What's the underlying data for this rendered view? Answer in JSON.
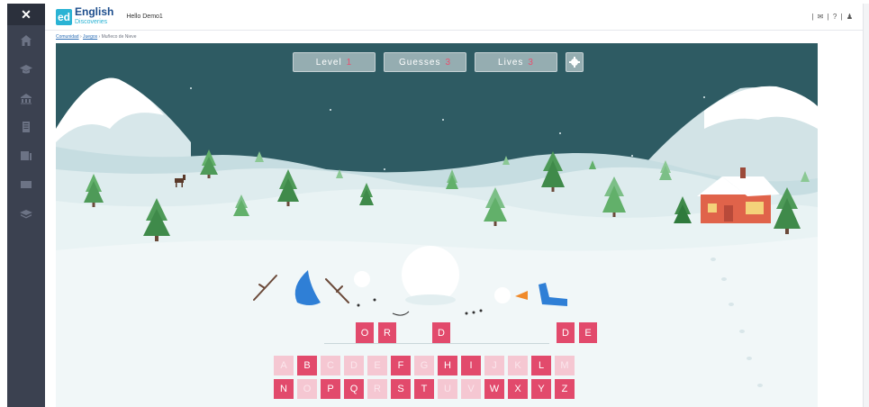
{
  "sidebar": {
    "close_label": "✕",
    "items": [
      {
        "icon": "home-icon"
      },
      {
        "icon": "graduation-cap-icon"
      },
      {
        "icon": "community-icon"
      },
      {
        "icon": "document-icon"
      },
      {
        "icon": "chart-icon"
      },
      {
        "icon": "mail-icon"
      },
      {
        "icon": "book-icon"
      }
    ]
  },
  "header": {
    "logo_abbr": "ed",
    "logo_line1": "English",
    "logo_line2": "Discoveries",
    "greeting": "Hello Demo1",
    "right_icons": "| ✉ | ? | ♟"
  },
  "breadcrumb": {
    "items": [
      "Comunidad",
      "Juegos"
    ],
    "current": "Muñeco de Nieve",
    "separator": " › "
  },
  "game": {
    "stats": {
      "level_label": "Level",
      "level_value": "1",
      "guesses_label": "Guesses",
      "guesses_value": "3",
      "lives_label": "Lives",
      "lives_value": "3"
    },
    "word_slots": [
      "",
      "O",
      "R",
      "",
      "D",
      "",
      "",
      "D",
      "E"
    ],
    "keyboard": {
      "row1": [
        {
          "letter": "A",
          "state": "off"
        },
        {
          "letter": "B",
          "state": "on"
        },
        {
          "letter": "C",
          "state": "off"
        },
        {
          "letter": "D",
          "state": "off"
        },
        {
          "letter": "E",
          "state": "off"
        },
        {
          "letter": "F",
          "state": "on"
        },
        {
          "letter": "G",
          "state": "off"
        },
        {
          "letter": "H",
          "state": "on"
        },
        {
          "letter": "I",
          "state": "on"
        },
        {
          "letter": "J",
          "state": "off"
        },
        {
          "letter": "K",
          "state": "off"
        },
        {
          "letter": "L",
          "state": "on"
        },
        {
          "letter": "M",
          "state": "off"
        }
      ],
      "row2": [
        {
          "letter": "N",
          "state": "on"
        },
        {
          "letter": "O",
          "state": "off"
        },
        {
          "letter": "P",
          "state": "on"
        },
        {
          "letter": "Q",
          "state": "on"
        },
        {
          "letter": "R",
          "state": "off"
        },
        {
          "letter": "S",
          "state": "on"
        },
        {
          "letter": "T",
          "state": "on"
        },
        {
          "letter": "U",
          "state": "off"
        },
        {
          "letter": "V",
          "state": "off"
        },
        {
          "letter": "W",
          "state": "on"
        },
        {
          "letter": "X",
          "state": "on"
        },
        {
          "letter": "Y",
          "state": "on"
        },
        {
          "letter": "Z",
          "state": "on"
        }
      ]
    }
  },
  "colors": {
    "accent": "#e24a6c",
    "accent_disabled": "#f5c7d2",
    "sidebar": "#3b4150",
    "sky": "#2f5a62"
  }
}
